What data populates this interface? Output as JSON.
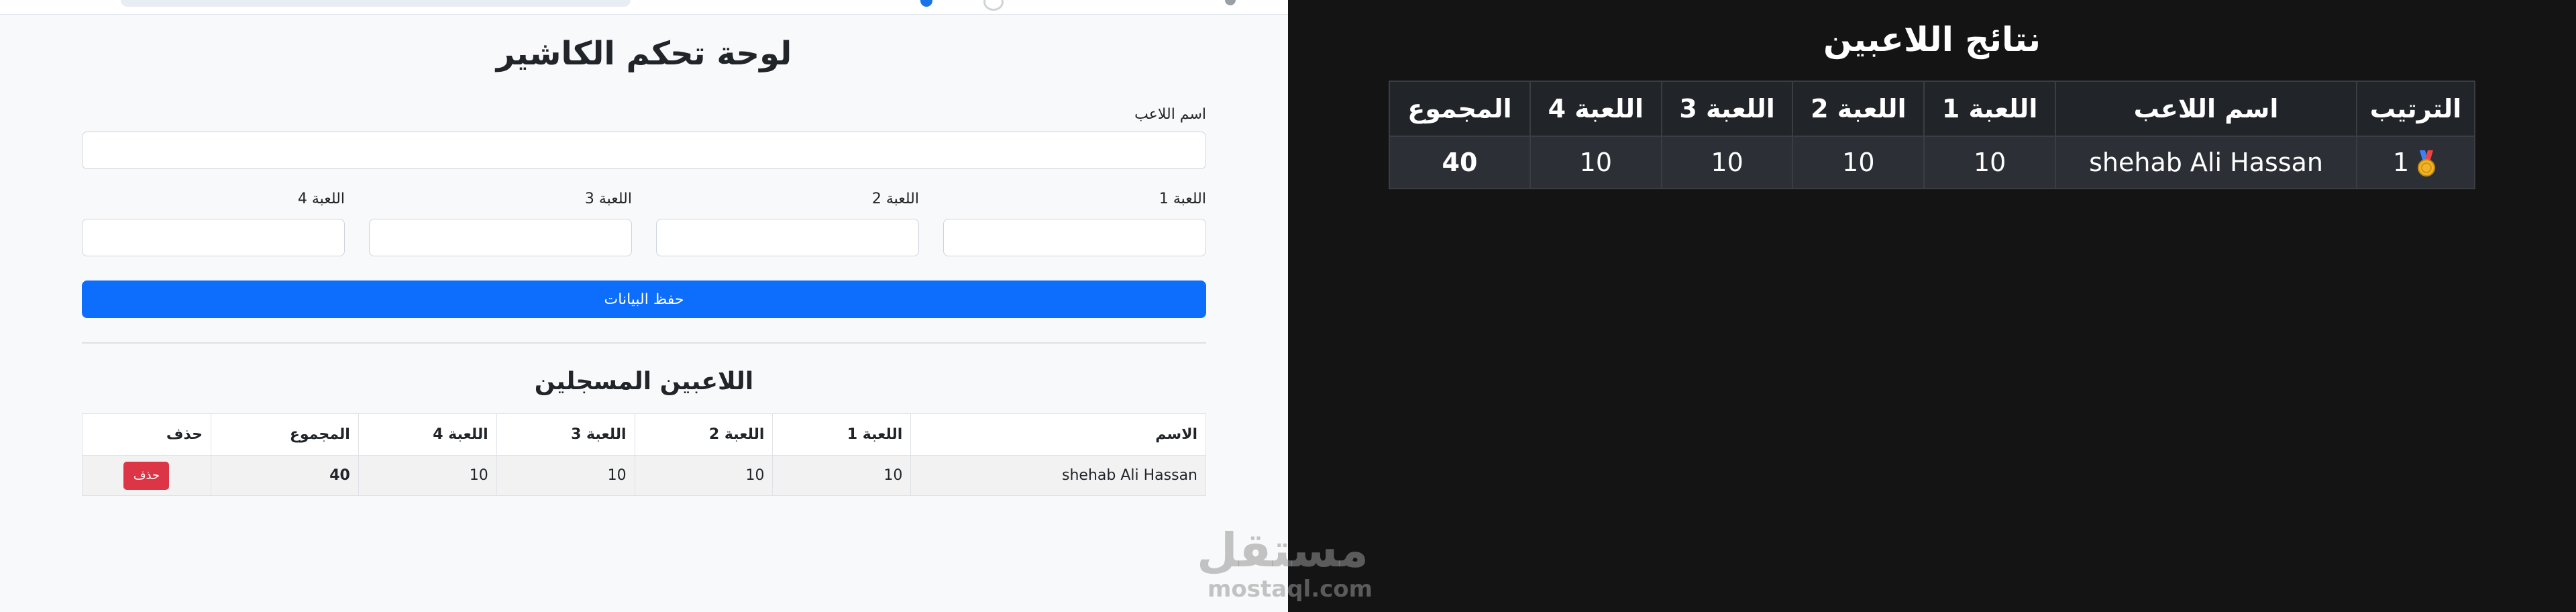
{
  "cashier": {
    "title": "لوحة تحكم الكاشير",
    "player_name_label": "اسم اللاعب",
    "player_name_value": "",
    "game_labels": [
      "اللعبة 1",
      "اللعبة 2",
      "اللعبة 3",
      "اللعبة 4"
    ],
    "game_values": [
      "",
      "",
      "",
      ""
    ],
    "save_label": "حفظ البيانات",
    "registered_title": "اللاعبين المسجلين",
    "table": {
      "headers": [
        "الاسم",
        "اللعبة 1",
        "اللعبة 2",
        "اللعبة 3",
        "اللعبة 4",
        "المجموع",
        "حذف"
      ],
      "rows": [
        {
          "name": "shehab Ali Hassan",
          "g1": "10",
          "g2": "10",
          "g3": "10",
          "g4": "10",
          "total": "40",
          "delete_label": "حذف"
        }
      ]
    }
  },
  "results": {
    "title": "نتائج اللاعبين",
    "headers": [
      "الترتيب",
      "اسم اللاعب",
      "اللعبة 1",
      "اللعبة 2",
      "اللعبة 3",
      "اللعبة 4",
      "المجموع"
    ],
    "rows": [
      {
        "rank": "1",
        "medal_icon": "gold-medal-icon",
        "name": "shehab Ali Hassan",
        "g1": "10",
        "g2": "10",
        "g3": "10",
        "g4": "10",
        "total": "40"
      }
    ]
  },
  "watermark": {
    "arabic": "مستقل",
    "latin": "mostaql.com"
  },
  "colors": {
    "primary": "#0d6efd",
    "danger": "#dc3545",
    "cashier_bg": "#f8f9fa",
    "results_bg": "#141414",
    "results_header": "#212529",
    "results_row": "#2c3036",
    "medal": "#f0b429"
  }
}
